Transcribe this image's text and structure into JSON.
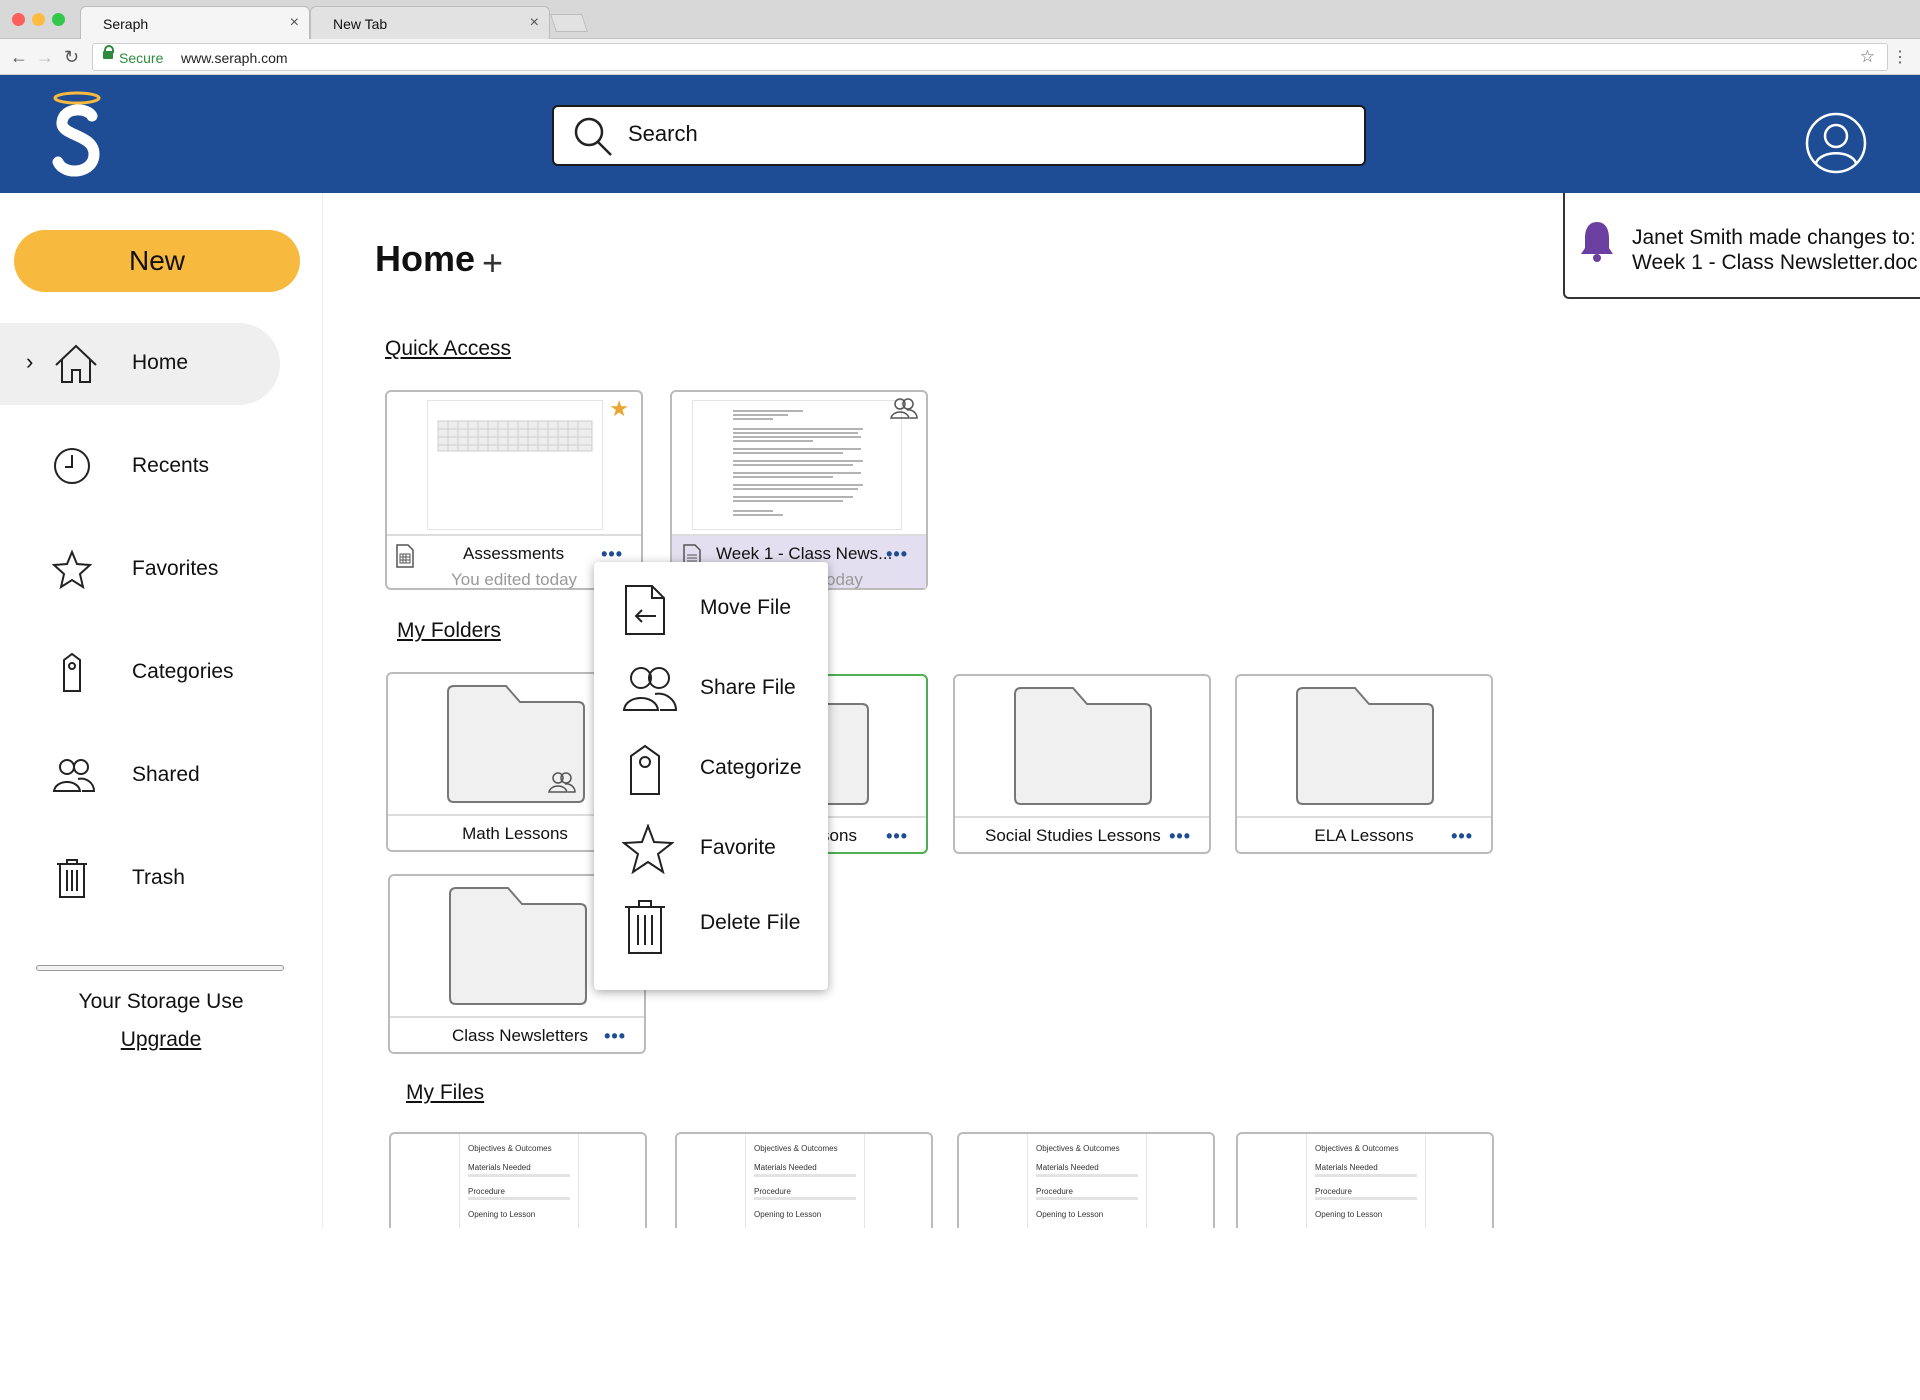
{
  "browser": {
    "tabs": [
      {
        "title": "Seraph",
        "close": "×"
      },
      {
        "title": "New Tab",
        "close": "×"
      }
    ],
    "secure_label": "Secure",
    "url": "www.seraph.com"
  },
  "header": {
    "search_placeholder": "Search",
    "brand_color": "#1e4d96"
  },
  "sidebar": {
    "new_button": "New",
    "items": [
      {
        "label": "Home",
        "icon": "home-icon",
        "active": true
      },
      {
        "label": "Recents",
        "icon": "clock-icon"
      },
      {
        "label": "Favorites",
        "icon": "star-icon"
      },
      {
        "label": "Categories",
        "icon": "tag-icon"
      },
      {
        "label": "Shared",
        "icon": "people-icon"
      },
      {
        "label": "Trash",
        "icon": "trash-icon"
      }
    ],
    "storage_label": "Your Storage Use",
    "upgrade_label": "Upgrade"
  },
  "notification": {
    "line1": "Janet Smith made changes to:",
    "line2": "Week 1 - Class Newsletter.doc"
  },
  "main": {
    "title": "Home",
    "add_symbol": "+",
    "quick_access_label": "Quick Access",
    "quick_access": [
      {
        "name": "Assessments",
        "sub": "You edited today",
        "more": "•••"
      },
      {
        "name": "Week 1 - Class News...",
        "sub": "oday",
        "more": "•••"
      }
    ],
    "my_folders_label": "My Folders",
    "folders": [
      {
        "name": "Math Lessons"
      },
      {
        "name": "sons",
        "more": "•••"
      },
      {
        "name": "Social Studies Lessons",
        "more": "•••"
      },
      {
        "name": "ELA Lessons",
        "more": "•••"
      },
      {
        "name": "Class Newsletters",
        "more": "•••"
      }
    ],
    "my_files_label": "My Files",
    "file_preview": {
      "line1": "Objectives & Outcomes",
      "line2": "Materials Needed",
      "line3": "Procedure",
      "line4": "Opening to Lesson"
    }
  },
  "context_menu": {
    "items": [
      {
        "label": "Move File",
        "icon": "move-file-icon"
      },
      {
        "label": "Share File",
        "icon": "share-people-icon"
      },
      {
        "label": "Categorize",
        "icon": "tag-icon"
      },
      {
        "label": "Favorite",
        "icon": "star-icon"
      },
      {
        "label": "Delete File",
        "icon": "trash-icon"
      }
    ]
  }
}
